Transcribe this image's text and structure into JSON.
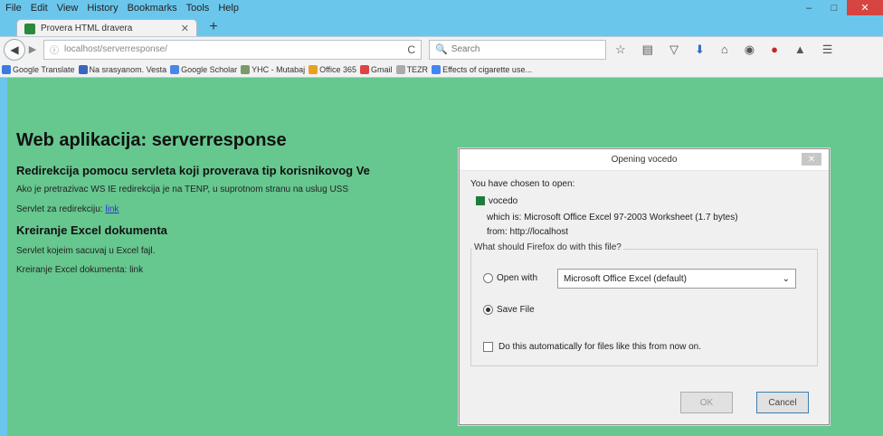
{
  "menubar": {
    "items": [
      "File",
      "Edit",
      "View",
      "History",
      "Bookmarks",
      "Tools",
      "Help"
    ]
  },
  "window_controls": {
    "minimize": "–",
    "maximize": "□",
    "close": "✕"
  },
  "tab": {
    "title": "Provera HTML dravera",
    "close": "✕",
    "new_tab": "+"
  },
  "navbar": {
    "back": "◀",
    "forward": "▶",
    "url_info": "ⓘ",
    "url": "localhost/serverresponse/",
    "reload": "C",
    "search_placeholder": "Search",
    "search_icon": "search-icon",
    "icons": [
      "star-icon",
      "clipboard-icon",
      "pocket-icon",
      "download-icon",
      "home-icon",
      "globe-icon",
      "addon-icon",
      "extension-icon",
      "hamburger-menu-icon"
    ]
  },
  "bookmarks": [
    {
      "label": "Google Translate",
      "color": "#3b7be0"
    },
    {
      "label": "Na srasyanom. Vesta",
      "color": "#3a65c0"
    },
    {
      "label": "Google Scholar",
      "color": "#4a86e8"
    },
    {
      "label": "YHC - Mutabaj",
      "color": "#7a9a6a"
    },
    {
      "label": "Office 365",
      "color": "#e8a020"
    },
    {
      "label": "Gmail",
      "color": "#d44"
    },
    {
      "label": "TEZR",
      "color": "#aaa"
    },
    {
      "label": "Effects of cigarette use...",
      "color": "#4285f4"
    }
  ],
  "page": {
    "title": "Web aplikacija: serverresponse",
    "h2_redirect": "Redirekcija pomocu servleta koji proverava tip korisnikovog Ve",
    "p_redirect": "Ako je pretrazivac WS IE redirekcija je na TENP, u suprotnom stranu na uslug USS",
    "p_servlet_label": "Servlet za redirekciju:",
    "p_servlet_link": "link",
    "h2_excel": "Kreiranje Excel dokumenta",
    "p_excel_servlet": "Servlet kojeim sacuvaj u Excel fajl.",
    "p_excel_doc": "Kreiranje Excel dokumenta: link"
  },
  "dialog": {
    "title": "Opening vocedo",
    "close": "✕",
    "chosen_label": "You have chosen to open:",
    "filename": "vocedo",
    "which_is": "which is: Microsoft Office Excel 97-2003 Worksheet (1.7 bytes)",
    "from": "from: http://localhost",
    "question": "What should Firefox do with this file?",
    "open_with_label": "Open with",
    "open_with_value": "Microsoft Office Excel (default)",
    "save_file_label": "Save File",
    "auto_label": "Do this automatically for files like this from now on.",
    "ok_label": "OK",
    "cancel_label": "Cancel"
  }
}
